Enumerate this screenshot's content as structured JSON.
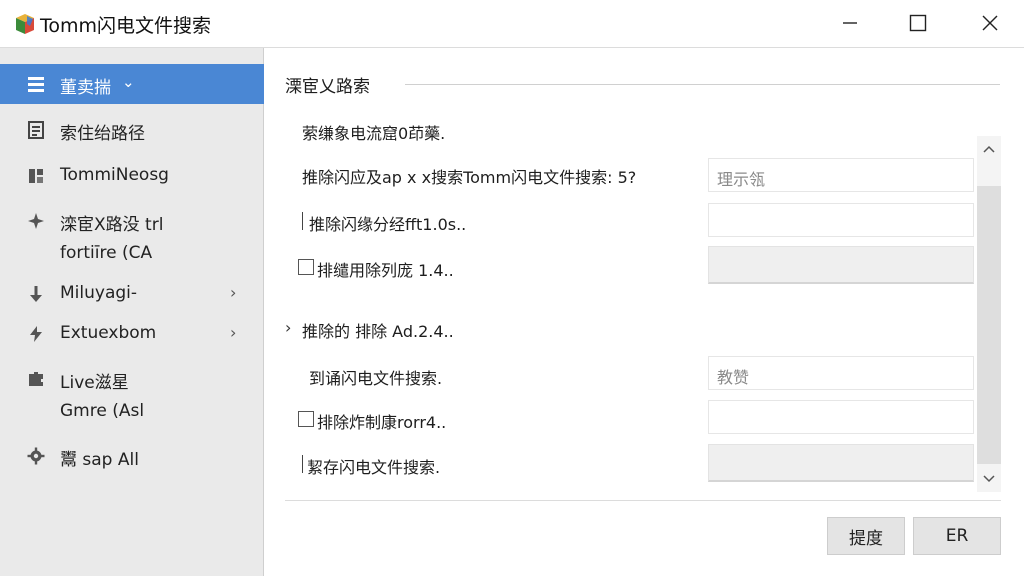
{
  "window": {
    "title": "Tomm闪电文件搜索",
    "controls": {
      "minimize": "—",
      "maximize": "☐",
      "close": "✕"
    }
  },
  "sidebar": {
    "items": [
      {
        "label": "董卖揣",
        "suffix": "⌄",
        "icon": "menu-lines-icon",
        "active": true
      },
      {
        "label": "索住绐路径",
        "icon": "document-icon"
      },
      {
        "label": "TommiNeosg",
        "icon": "grid-icon"
      },
      {
        "label": "滦宦X路没 trl",
        "sublabel": "fortiīre (CA",
        "icon": "sparkle-icon"
      },
      {
        "label": "Miluyagi-",
        "icon": "arrow-down-icon",
        "chevron": "›"
      },
      {
        "label": "Extuexbom",
        "icon": "bolt-icon",
        "chevron": "›"
      },
      {
        "label": "Live滋星",
        "sublabel": "Gmre (Asl",
        "icon": "puzzle-icon"
      },
      {
        "label": "鬻 sap All",
        "icon": "gear-icon"
      }
    ]
  },
  "main": {
    "section_title": "溧宦乂路索",
    "rows": [
      {
        "text": "萦缣象电流窟0茚藥."
      },
      {
        "text": "推除闪应及ap x x搜索Tomm闪电文件搜索: 5?",
        "field_placeholder": "理示瓴"
      },
      {
        "text": "推除闪缘分经fft1.0s.."
      },
      {
        "text": "排缱用除列庞 1.4..",
        "checkbox": false
      },
      {
        "text": "推除的 排除 Ad.2.4..",
        "expander": "›"
      },
      {
        "text": "到诵闪电文件搜索.",
        "field_placeholder": "教赞"
      },
      {
        "text": "排除炸制康rorr4..",
        "checkbox": false
      },
      {
        "text": "絜存闪电文件搜索."
      }
    ],
    "buttons": {
      "ok": "提度",
      "cancel": "ER"
    },
    "scroll": {
      "up": "⌃",
      "down": "⌄"
    }
  }
}
